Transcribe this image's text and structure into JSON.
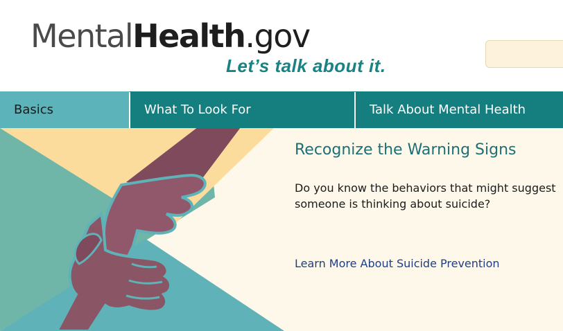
{
  "header": {
    "logo": {
      "part1": "Mental",
      "part2": "Health",
      "part3": ".gov"
    },
    "tagline": "Let’s talk about it.",
    "search": {
      "placeholder": ""
    }
  },
  "nav": {
    "items": [
      {
        "label": "Basics",
        "active": true
      },
      {
        "label": "What To Look For",
        "active": false
      },
      {
        "label": "Talk About Mental Health",
        "active": false
      }
    ]
  },
  "hero": {
    "title": "Recognize the Warning Signs",
    "text": "Do you know the behaviors that might suggest someone is thinking about suicide?",
    "link": "Learn More About Suicide Prevention",
    "image_icon": "helping-hands-illustration"
  },
  "colors": {
    "teal": "#157f80",
    "teal_light": "#5cb3b9",
    "cream": "#fdf8ea",
    "yellow": "#fcdc9c",
    "hand": "#8a5666",
    "link": "#1f3e85"
  }
}
